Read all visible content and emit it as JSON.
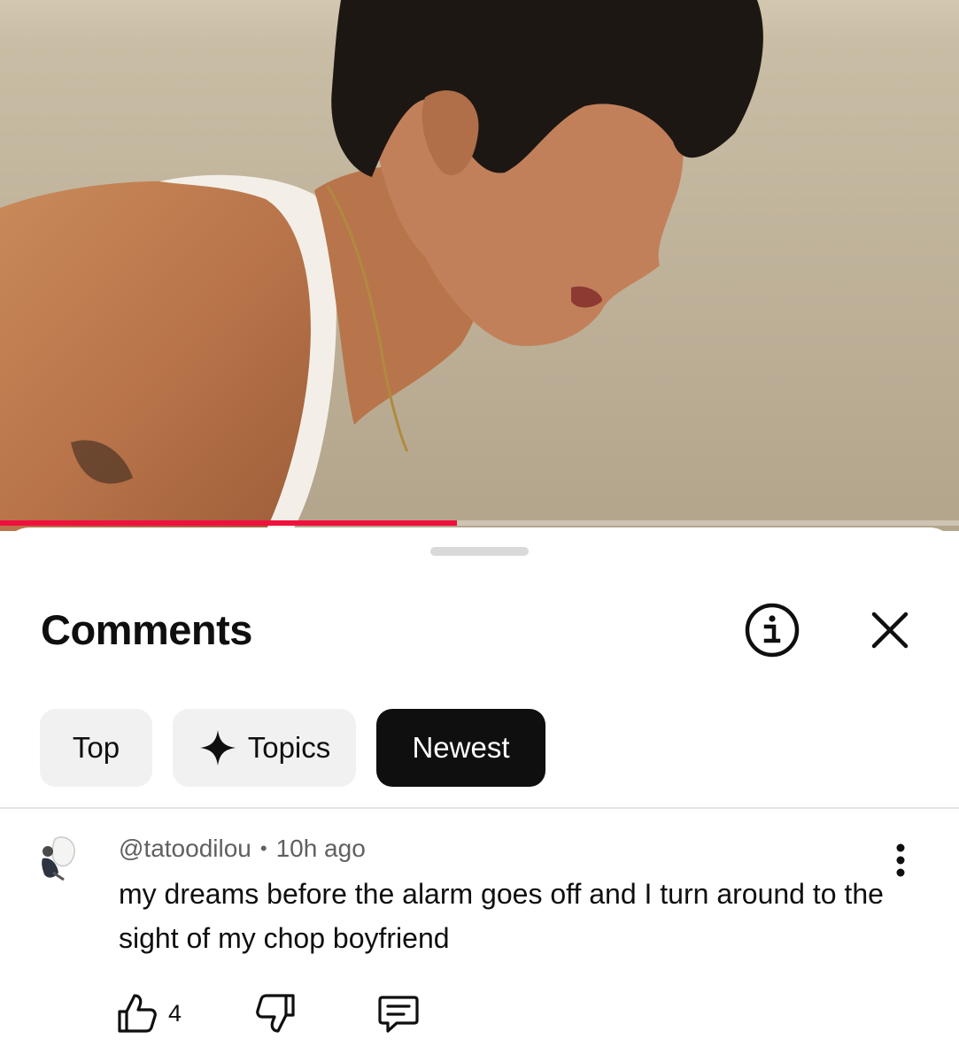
{
  "video": {
    "progress_fraction": 0.476,
    "accent_color": "#f0103e"
  },
  "comments_panel": {
    "title": "Comments",
    "info_icon": "info-circle-icon",
    "close_icon": "close-x-icon",
    "filters": [
      {
        "label": "Top",
        "selected": false
      },
      {
        "label": "Topics",
        "selected": false,
        "icon": "sparkle-icon"
      },
      {
        "label": "Newest",
        "selected": true
      }
    ]
  },
  "comments": [
    {
      "author": "@tatoodilou",
      "separator": "•",
      "time": "10h ago",
      "text": "my dreams before the alarm goes off and I turn around to the sight of my chop boyfriend",
      "like_count": "4",
      "icons": [
        "thumbs-up-icon",
        "thumbs-down-icon",
        "reply-icon",
        "more-vertical-icon"
      ]
    }
  ]
}
